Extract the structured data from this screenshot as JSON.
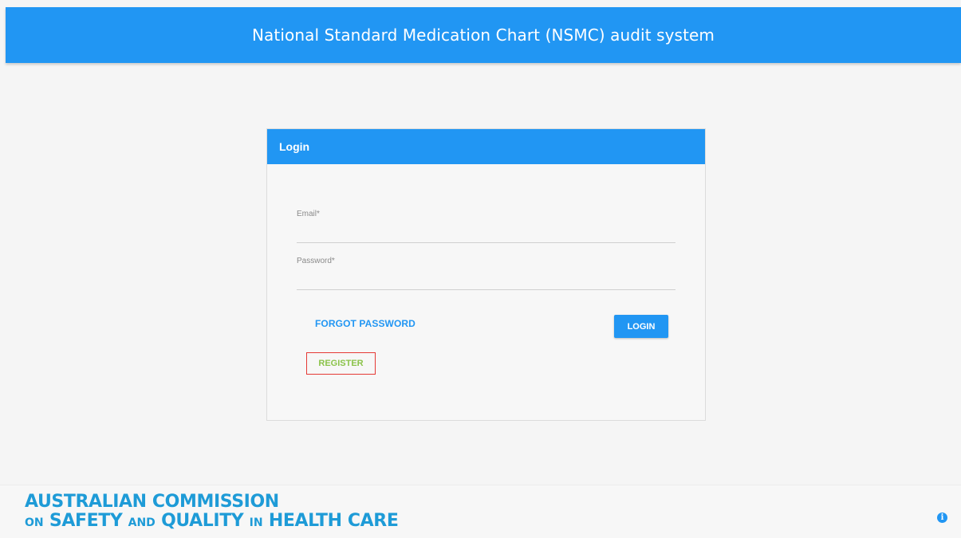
{
  "header": {
    "title": "National Standard Medication Chart (NSMC) audit system"
  },
  "login_card": {
    "title": "Login",
    "email": {
      "label": "Email*",
      "value": ""
    },
    "password": {
      "label": "Password*",
      "value": ""
    },
    "forgot_password_label": "FORGOT PASSWORD",
    "login_label": "LOGIN",
    "register_label": "REGISTER"
  },
  "footer": {
    "logo": {
      "line1": "AUSTRALIAN COMMISSION",
      "line2_parts": [
        "ON",
        "SAFETY",
        "AND",
        "QUALITY",
        "IN",
        "HEALTH CARE"
      ]
    },
    "info_icon": "info-icon"
  },
  "colors": {
    "primary": "#2196f3",
    "background": "#f5f5f5",
    "register_text": "#8bc34a",
    "register_outline": "#e53935",
    "logo": "#1e9bd7"
  }
}
